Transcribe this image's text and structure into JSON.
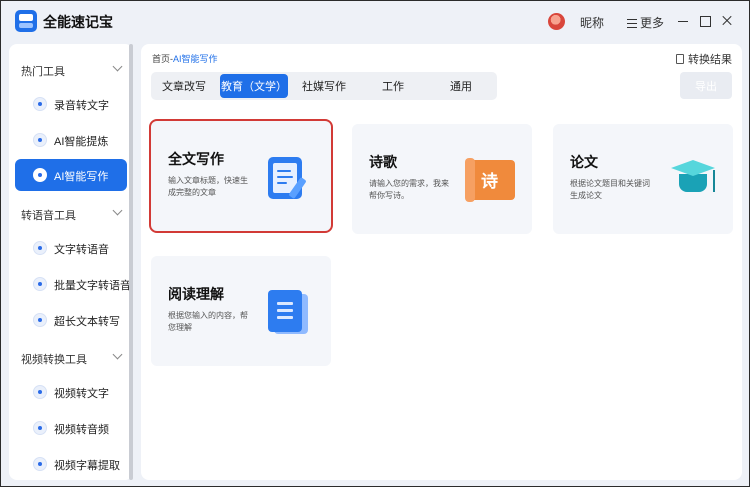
{
  "app": {
    "title": "全能速记宝"
  },
  "header": {
    "nickname": "昵称",
    "more_label": "更多"
  },
  "sidebar": {
    "groups": [
      {
        "label": "热门工具",
        "items": [
          {
            "label": "录音转文字"
          },
          {
            "label": "AI智能提炼"
          },
          {
            "label": "AI智能写作"
          }
        ]
      },
      {
        "label": "转语音工具",
        "items": [
          {
            "label": "文字转语音"
          },
          {
            "label": "批量文字转语音"
          },
          {
            "label": "超长文本转写"
          }
        ]
      },
      {
        "label": "视频转换工具",
        "items": [
          {
            "label": "视频转文字"
          },
          {
            "label": "视频转音频"
          },
          {
            "label": "视频字幕提取"
          }
        ]
      }
    ],
    "active_item": "AI智能写作"
  },
  "main": {
    "breadcrumb": {
      "home": "首页",
      "separator": "-",
      "current": "AI智能写作"
    },
    "convert_result": "转换结果",
    "export_label": "导出",
    "tabs": [
      {
        "label": "文章改写"
      },
      {
        "label": "教育（文学）"
      },
      {
        "label": "社媒写作"
      },
      {
        "label": "工作"
      },
      {
        "label": "通用"
      }
    ],
    "active_tab": "教育（文学）",
    "cards": [
      {
        "title": "全文写作",
        "desc": "输入文章标题，快速生成完整的文章",
        "icon": "notebook-pen-icon"
      },
      {
        "title": "诗歌",
        "desc": "请输入您的需求，我来帮你写诗。",
        "icon": "poem-scroll-icon",
        "glyph": "诗"
      },
      {
        "title": "论文",
        "desc": "根据论文题目和关键词生成论文",
        "icon": "graduation-cap-icon"
      },
      {
        "title": "阅读理解",
        "desc": "根据您输入的内容，帮您理解",
        "icon": "book-icon"
      }
    ],
    "selected_card": "全文写作"
  },
  "colors": {
    "accent": "#1f6fe8",
    "selection_outline": "#d23a36",
    "card_bg": "#f4f6fa"
  }
}
